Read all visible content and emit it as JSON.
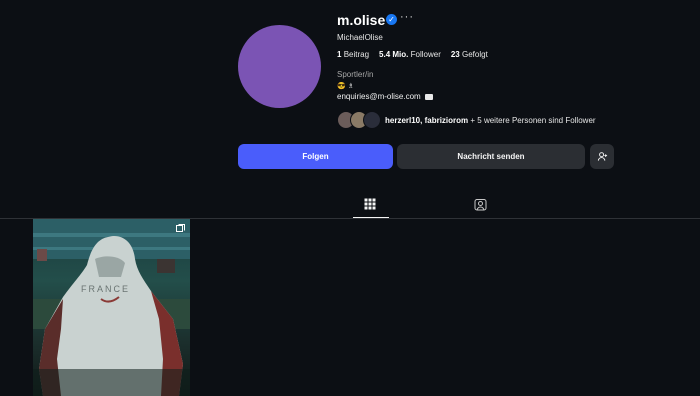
{
  "profile": {
    "username": "m.olise",
    "full_name": "MichaelOlise",
    "stats": {
      "posts": "1",
      "posts_label": "Beitrag",
      "followers": "5.4 Mio.",
      "followers_label": "Follower",
      "following": "23",
      "following_label": "Gefolgt"
    },
    "category": "Sportler/in",
    "bio_emojis": "😎 ♗",
    "email": "enquiries@m-olise.com",
    "followed_by": {
      "names": "herzerl10, fabriziorom",
      "rest": "+ 5 weitere Personen sind Follower"
    }
  },
  "actions": {
    "follow": "Folgen",
    "message": "Nachricht senden"
  },
  "colors": {
    "background": "#0c0f14",
    "follow_button": "#4a5dfb",
    "secondary_button": "#2b2e33",
    "avatar": "#7b54b4",
    "verified": "#1877f2"
  },
  "icons": {
    "verified": "verified-badge-icon",
    "more": "more-options-icon",
    "add_user": "add-person-icon",
    "posts_tab": "grid-icon",
    "tagged_tab": "tagged-person-icon",
    "multi": "multiple-images-icon"
  },
  "post": {
    "caption_text": "FRANCE"
  }
}
